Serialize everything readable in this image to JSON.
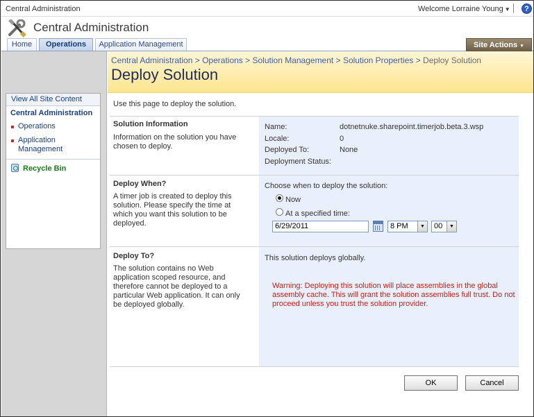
{
  "topbar": {
    "site_name": "Central Administration",
    "welcome": "Welcome Lorraine Young",
    "welcome_arrow": "▼",
    "help_icon": "?"
  },
  "header": {
    "title": "Central Administration",
    "logo_icon": "tools-icon"
  },
  "tabs": [
    {
      "label": "Home"
    },
    {
      "label": "Operations",
      "selected": true
    },
    {
      "label": "Application Management"
    }
  ],
  "site_actions": {
    "label": "Site Actions",
    "arrow": "▼"
  },
  "leftnav": {
    "view_all": "View All Site Content",
    "heading": "Central Administration",
    "items": [
      {
        "label": "Operations"
      },
      {
        "label": "Application Management"
      }
    ],
    "recycle_bin": "Recycle Bin"
  },
  "breadcrumb": {
    "items": [
      "Central Administration",
      "Operations",
      "Solution Management",
      "Solution Properties"
    ],
    "current": "Deploy Solution",
    "separator": ">"
  },
  "page": {
    "title": "Deploy Solution",
    "intro": "Use this page to deploy the solution."
  },
  "solution_info": {
    "title": "Solution Information",
    "description": "Information on the solution you have chosen to deploy.",
    "fields": [
      {
        "label": "Name:",
        "value": "dotnetnuke.sharepoint.timerjob.beta.3.wsp"
      },
      {
        "label": "Locale:",
        "value": "0"
      },
      {
        "label": "Deployed To:",
        "value": "None"
      },
      {
        "label": "Deployment Status:",
        "value": ""
      }
    ]
  },
  "deploy_when": {
    "title": "Deploy When?",
    "description": "A timer job is created to deploy this solution. Please specify the time at which you want this solution to be deployed.",
    "prompt": "Choose when to deploy the solution:",
    "option_now": "Now",
    "option_specified": "At a specified time:",
    "selected": "now",
    "date": "6/29/2011",
    "hour": "8 PM",
    "minute": "00"
  },
  "deploy_to": {
    "title": "Deploy To?",
    "description": "The solution contains no Web application scoped resource, and therefore cannot be deployed to a particular Web application. It can only be deployed globally.",
    "info": "This solution deploys globally.",
    "warning": "Warning: Deploying this solution will place assemblies in the global assembly cache. This will grant the solution assemblies full trust. Do not proceed unless you trust the solution provider."
  },
  "buttons": {
    "ok": "OK",
    "cancel": "Cancel"
  },
  "colors": {
    "site_actions_bg": "#7d6f56",
    "page_header_bg": "#ffe58f",
    "right_panel_bg": "#eaf0fb",
    "warning_text": "#c0201a",
    "link": "#1b3f7a"
  }
}
